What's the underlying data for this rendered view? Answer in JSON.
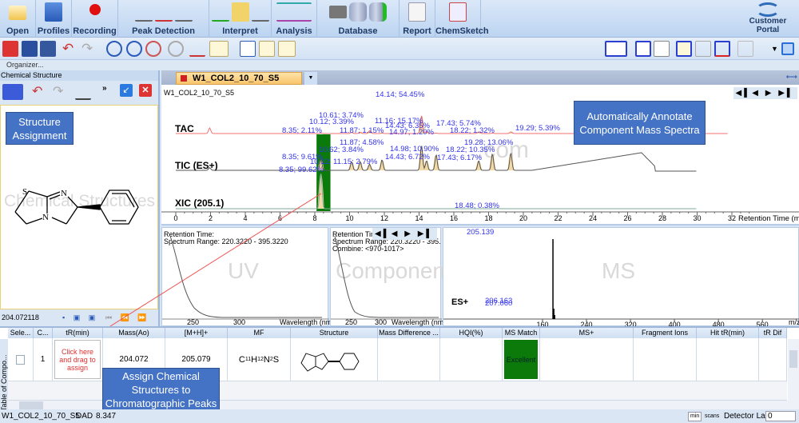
{
  "ribbon": {
    "groups": [
      {
        "label": "Open"
      },
      {
        "label": "Profiles"
      },
      {
        "label": "Recording"
      },
      {
        "label": "Peak Detection"
      },
      {
        "label": "Interpret"
      },
      {
        "label": "Analysis"
      },
      {
        "label": "Database"
      },
      {
        "label": "Report"
      },
      {
        "label": "ChemSketch"
      }
    ],
    "customer_portal": "Customer Portal"
  },
  "organizer": "Organizer...",
  "left_panel": {
    "title": "Chemical Structure",
    "mass_value": "204.072118",
    "watermark": "Chemical Structures",
    "structure_atoms": {
      "s": "S",
      "n1": "N",
      "n2": "N"
    }
  },
  "callouts": {
    "structure": "Structure Assignment",
    "annotate": "Automatically Annotate Component Mass Spectra",
    "assign": "Assign Chemical Structures to Chromatographic Peaks"
  },
  "document": {
    "tab": "W1_COL2_10_70_S5",
    "chart_title": "W1_COL2_10_70_S5"
  },
  "chart_data": [
    {
      "type": "line",
      "title": "Chromatograms",
      "xlabel": "Retention Time (min)",
      "xlim": [
        0,
        32
      ],
      "xticks": [
        0,
        2,
        4,
        6,
        8,
        10,
        12,
        14,
        16,
        18,
        20,
        22,
        24,
        26,
        28,
        30,
        32
      ],
      "selected_range": [
        8.1,
        8.9
      ],
      "series": [
        {
          "name": "TAC",
          "color": "#f07070",
          "peaks": [
            [
              1.95,
              0.5
            ],
            [
              8.35,
              0.05
            ],
            [
              10.12,
              0.1
            ],
            [
              10.61,
              0.12
            ],
            [
              11.16,
              0.25
            ],
            [
              11.87,
              0.05
            ],
            [
              14.14,
              1.6
            ],
            [
              14.43,
              0.18
            ],
            [
              14.97,
              0.04
            ],
            [
              17.43,
              0.15
            ],
            [
              18.22,
              0.04
            ],
            [
              19.29,
              0.15
            ]
          ],
          "labels": [
            "8.35; 2.11%",
            "10.12; 3.39%",
            "10.61; 3.74%",
            "11.87; 1.15%",
            "11.16; 15.17%",
            "14.43; 6.35%",
            "14.97; 1.20%",
            "14.14; 54.45%",
            "17.43; 5.74%",
            "18.22; 1.32%",
            "19.29; 5.39%"
          ]
        },
        {
          "name": "TIC (ES+)",
          "color": "#555555",
          "peaks": [
            [
              1.95,
              0.15
            ],
            [
              8.35,
              0.6
            ],
            [
              10.12,
              0.5
            ],
            [
              10.61,
              0.5
            ],
            [
              11.15,
              0.35
            ],
            [
              11.87,
              0.6
            ],
            [
              14.14,
              1.4
            ],
            [
              14.43,
              0.55
            ],
            [
              14.98,
              0.9
            ],
            [
              17.43,
              0.55
            ],
            [
              18.22,
              0.95
            ],
            [
              19.28,
              1.0
            ]
          ],
          "labels": [
            "8.35; 9.61%",
            "10.62; 3.84%",
            "10.12; 11.15; 2.79%",
            "11.87; 4.58%",
            "14.43; 6.72%",
            "14.98; 10.90%",
            "17.43; 6.17%",
            "18.22; 10.35%",
            "19.28; 13.06%"
          ]
        },
        {
          "name": "XIC (205.1)",
          "color": "#7fa99b",
          "peaks": [
            [
              8.35,
              2.0
            ],
            [
              18.48,
              0.02
            ]
          ],
          "labels": [
            "8.35; 99.62%",
            "18.48; 0.38%"
          ]
        }
      ]
    },
    {
      "type": "line",
      "title": "UV",
      "retention_time_label": "Retention Time:",
      "spectrum_range": "Spectrum Range: 220.3220 - 395.3220",
      "xlabel": "Wavelength (nm)",
      "xticks": [
        250,
        300
      ]
    },
    {
      "type": "line",
      "title": "Component",
      "retention_time_label": "Retention Time:",
      "spectrum_range": "Spectrum Range: 220.3220 - 395.32",
      "combine": "Combine: <970-1017>",
      "xlabel": "Wavelength (nm)",
      "xticks": [
        250,
        300
      ]
    },
    {
      "type": "bar",
      "title": "MS",
      "ion_mode": "ES+",
      "xlabel": "m/z",
      "xticks": [
        160,
        240,
        320,
        400,
        480,
        560,
        640,
        720,
        800
      ],
      "peaks": [
        {
          "mz": 205.139,
          "label": "205.139",
          "rel": 100
        },
        {
          "mz": 206.163,
          "label": "206.163",
          "rel": 13
        },
        {
          "mz": 207.06,
          "label": "207.060",
          "rel": 5
        }
      ]
    }
  ],
  "table": {
    "side_label": "Table of Compo...",
    "columns": [
      "Sele...",
      "C...",
      "tR(min)",
      "Mass(Ao)",
      "[M+H]+",
      "MF",
      "Structure",
      "Mass Difference ...",
      "HQI(%)",
      "MS Match",
      "MS+",
      "Fragment Ions",
      "Hit tR(min)",
      "tR Dif"
    ],
    "rows": [
      {
        "index": "1",
        "tr": "Click here and drag to assign",
        "mass": "204.072",
        "mh": "205.079",
        "mf_parts": [
          "C",
          "11",
          "H",
          "12",
          "N",
          "2",
          "S"
        ],
        "ms_match": "Excellent"
      }
    ]
  },
  "status": {
    "file": "W1_COL2_10_70_S5",
    "detector": "DAD",
    "value": "8.347",
    "unit_min": "min",
    "unit_scans": "scans",
    "detector_lag_label": "Detector Lag:",
    "detector_lag": "0"
  }
}
